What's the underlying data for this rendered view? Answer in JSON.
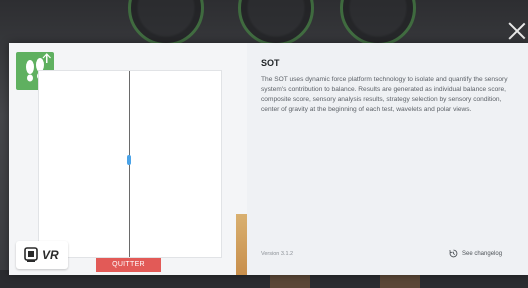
{
  "modal": {
    "title": "SOT",
    "description": "The SOT uses dynamic force platform technology to isolate and quantify the sensory system's contribution to balance. Results are generated as individual balance score, composite score, sensory analysis results, strategy selection by sensory condition, center of gravity at the beginning of each test, wavelets and polar views.",
    "version": "Version 3.1.2",
    "changelog_label": "See changelog",
    "quit_label": "QUITTER",
    "vr_label": "VR"
  },
  "colors": {
    "accent_green": "#5fb060",
    "quit_red": "#e25a57",
    "marker_blue": "#4aa3e8"
  },
  "icons": [
    "footprints-icon",
    "vr-headset-icon",
    "close-icon",
    "changelog-icon"
  ]
}
